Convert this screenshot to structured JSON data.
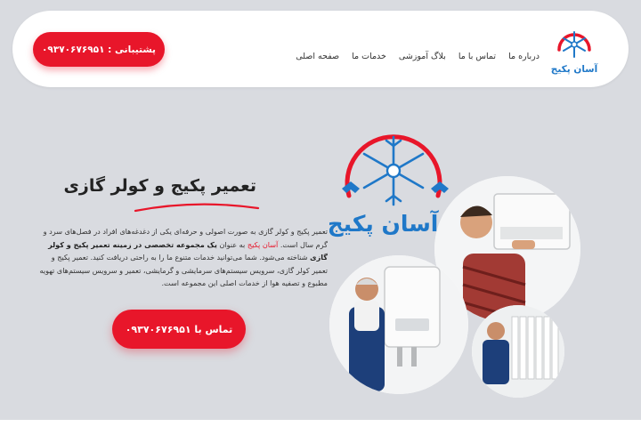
{
  "brand": {
    "name": "آسان پکیج"
  },
  "nav": {
    "items": [
      "صفحه اصلی",
      "خدمات ما",
      "بلاگ آموزشی",
      "تماس با ما",
      "درباره ما"
    ]
  },
  "header": {
    "support_label": "پشتیبانی : ۰۹۳۷۰۶۷۶۹۵۱"
  },
  "hero": {
    "title": "تعمیر پکیج و کولر گازی",
    "p1": "تعمیر پکیج و کولر گازی به صورت اصولی و حرفه‌ای یکی از دغدغه‌های افراد در فصل‌های سرد و گرم سال است. ",
    "brand_inline": "آسان پکیج",
    "p2": " به عنوان ",
    "p3_bold": "یک مجموعه تخصصی در زمینه تعمیر پکیج و کولر گازی",
    "p4": " شناخته می‌شود. شما می‌توانید خدمات متنوع ما را به راحتی دریافت کنید. تعمیر پکیج و تعمیر کولر گازی، سرویس سیستم‌های سرمایشی و گرمایشی، تعمیر و سرویس سیستم‌های تهویه مطبوع و تصفیه هوا از خدمات اصلی این مجموعه است.",
    "cta_label": "تماس با ۰۹۳۷۰۶۷۶۹۵۱",
    "art_brand": "آسان پکیج"
  },
  "colors": {
    "accent": "#e8162a",
    "snowflake": "#1f78c8",
    "background": "#d9dbe0"
  }
}
